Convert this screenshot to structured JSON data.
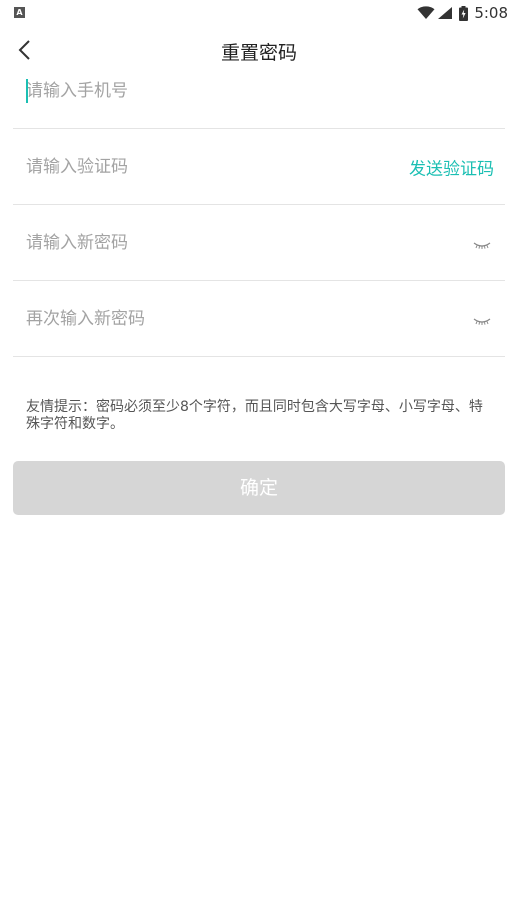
{
  "status_bar": {
    "app_icon_letter": "A",
    "time": "5:08"
  },
  "header": {
    "title": "重置密码"
  },
  "form": {
    "phone": {
      "placeholder": "请输入手机号",
      "value": ""
    },
    "code": {
      "placeholder": "请输入验证码",
      "value": "",
      "send_label": "发送验证码"
    },
    "new_password": {
      "placeholder": "请输入新密码",
      "value": ""
    },
    "confirm_password": {
      "placeholder": "再次输入新密码",
      "value": ""
    }
  },
  "tip": "友情提示：密码必须至少8个字符，而且同时包含大写字母、小写字母、特殊字符和数字。",
  "confirm_button_label": "确定",
  "colors": {
    "accent": "#1bbfb3",
    "button_disabled": "#d6d6d6",
    "divider": "#e4e4e4",
    "placeholder": "#a3a3a3"
  },
  "icons": {
    "back": "chevron-left-icon",
    "eye": "eye-closed-icon",
    "wifi": "wifi-icon",
    "signal": "signal-icon",
    "battery": "battery-charging-icon"
  }
}
